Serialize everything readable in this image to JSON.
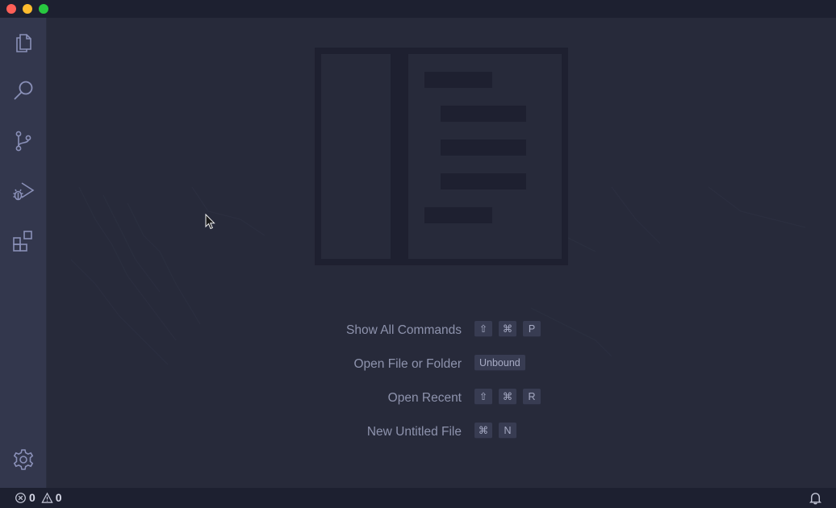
{
  "window": {
    "controls": [
      "close",
      "minimize",
      "maximize"
    ]
  },
  "activity_bar": {
    "items": [
      {
        "name": "explorer",
        "icon": "files-icon"
      },
      {
        "name": "search",
        "icon": "search-icon"
      },
      {
        "name": "source-control",
        "icon": "source-control-icon"
      },
      {
        "name": "run-and-debug",
        "icon": "run-debug-icon"
      },
      {
        "name": "extensions",
        "icon": "extensions-icon"
      }
    ],
    "bottom": {
      "name": "manage",
      "icon": "gear-icon"
    }
  },
  "editor": {
    "watermark_icon": "editor-layout-icon",
    "shortcuts": [
      {
        "label": "Show All Commands",
        "keys": [
          "⇧",
          "⌘",
          "P"
        ]
      },
      {
        "label": "Open File or Folder",
        "keys": [
          "Unbound"
        ]
      },
      {
        "label": "Open Recent",
        "keys": [
          "⇧",
          "⌘",
          "R"
        ]
      },
      {
        "label": "New Untitled File",
        "keys": [
          "⌘",
          "N"
        ]
      }
    ]
  },
  "status_bar": {
    "errors": "0",
    "warnings": "0",
    "right_icon": "bell-icon"
  },
  "colors": {
    "background": "#272a3a",
    "activity_bar": "#33374d",
    "status_bar": "#1d2030",
    "icon": "#8a90b8",
    "text": "#8e93ad"
  }
}
